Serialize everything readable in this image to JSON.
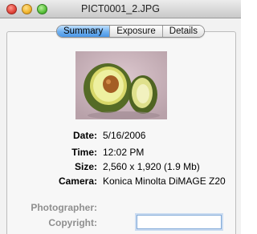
{
  "window": {
    "title": "PICT0001_2.JPG"
  },
  "tabs": [
    {
      "label": "Summary"
    },
    {
      "label": "Exposure"
    },
    {
      "label": "Details"
    }
  ],
  "active_tab": "Summary",
  "info": {
    "date_label": "Date:",
    "date_value": "5/16/2006",
    "time_label": "Time:",
    "time_value": "12:02 PM",
    "size_label": "Size:",
    "size_value": "2,560 x 1,920 (1.9 Mb)",
    "camera_label": "Camera:",
    "camera_value": "Konica Minolta DiMAGE Z20",
    "photographer_label": "Photographer:",
    "copyright_label": "Copyright:",
    "copyright_value": ""
  },
  "colors": {
    "tab_active": "#5aa2ec",
    "dim_label": "#8f8f8f",
    "field_focus": "#7fa8d8"
  }
}
